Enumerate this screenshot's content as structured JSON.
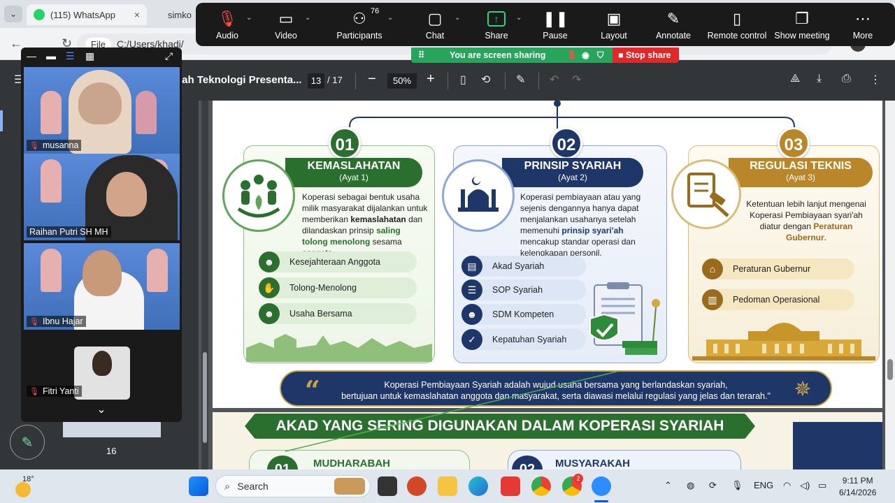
{
  "browser": {
    "tabs": [
      {
        "label": "(115) WhatsApp",
        "close": "×"
      },
      {
        "label": "simko"
      }
    ],
    "address": {
      "scheme_label": "File",
      "path": "C:/Users/khadi/"
    }
  },
  "pdf_toolbar": {
    "title": "iah Teknologi Presenta...",
    "page_current": "13",
    "page_total": "/ 17",
    "zoom": "50%",
    "zoom_out": "−",
    "zoom_in": "+"
  },
  "pdf_sidebar": {
    "thumb_page_number": "16"
  },
  "zoom_toolbar": {
    "items": [
      {
        "label": "Audio",
        "icon": "mic-muted-icon"
      },
      {
        "label": "Video",
        "icon": "video-icon"
      },
      {
        "label": "Participants",
        "icon": "participants-icon",
        "count": "76"
      },
      {
        "label": "Chat",
        "icon": "chat-icon"
      },
      {
        "label": "Share",
        "icon": "share-icon"
      },
      {
        "label": "Pause",
        "icon": "pause-icon"
      },
      {
        "label": "Layout",
        "icon": "layout-icon"
      },
      {
        "label": "Annotate",
        "icon": "pen-icon"
      },
      {
        "label": "Remote control",
        "icon": "mouse-icon"
      },
      {
        "label": "Show meeting",
        "icon": "window-icon"
      },
      {
        "label": "More",
        "icon": "more-icon"
      }
    ],
    "sharing_status": "You are screen sharing",
    "stop_share": "Stop share"
  },
  "gallery": {
    "participants": [
      {
        "name": "musanna"
      },
      {
        "name": "Raihan Putri SH MH"
      },
      {
        "name": "Ibnu Hajar"
      },
      {
        "name": "Fitri Yanti"
      }
    ]
  },
  "slide": {
    "cards": [
      {
        "number": "01",
        "title": "KEMASLAHATAN",
        "subtitle": "(Ayat 1)",
        "desc_parts": [
          "Koperasi sebagai bentuk usaha milik masyarakat dijalankan untuk memberikan ",
          "kemaslahatan",
          " dan dilandaskan prinsip ",
          "saling tolong menolong",
          " sesama anggota."
        ],
        "items": [
          "Kesejahteraan Anggota",
          "Tolong-Menolong",
          "Usaha Bersama"
        ]
      },
      {
        "number": "02",
        "title": "PRINSIP SYARIAH",
        "subtitle": "(Ayat 2)",
        "desc_parts": [
          "Koperasi pembiayaan atau yang sejenis dengannya hanya dapat menjalankan usahanya setelah memenuhi ",
          "prinsip syari'ah",
          " mencakup standar operasi dan kelengkapan personil."
        ],
        "items": [
          "Akad Syariah",
          "SOP Syariah",
          "SDM Kompeten",
          "Kepatuhan Syariah"
        ]
      },
      {
        "number": "03",
        "title": "REGULASI TEKNIS",
        "subtitle": "(Ayat 3)",
        "desc_parts": [
          "Ketentuan lebih lanjut mengenai Koperasi Pembiayaan syari'ah diatur dengan ",
          "Peraturan Gubernur",
          "."
        ],
        "items": [
          "Peraturan Gubernur",
          "Pedoman Operasional"
        ]
      }
    ],
    "quote_line1": "Koperasi Pembiayaan Syariah adalah wujud usaha bersama yang berlandaskan syariah,",
    "quote_line2": "bertujuan untuk kemaslahatan anggota dan masyarakat, serta diawasi melalui regulasi yang jelas dan terarah.\"",
    "next_heading": "AKAD YANG SERING DIGUNAKAN DALAM KOPERASI SYARIAH",
    "next_items": [
      {
        "number": "01",
        "label": "MUDHARABAH"
      },
      {
        "number": "02",
        "label": "MUSYARAKAH"
      }
    ],
    "colors": {
      "green": "#2b6f2f",
      "navy": "#1e3668",
      "gold": "#b9872a"
    }
  },
  "taskbar": {
    "weather": "18°",
    "search_placeholder": "Search",
    "language": "ENG",
    "time": "9:11 PM",
    "date": "6/14/2026",
    "chrome_badge": "2"
  }
}
